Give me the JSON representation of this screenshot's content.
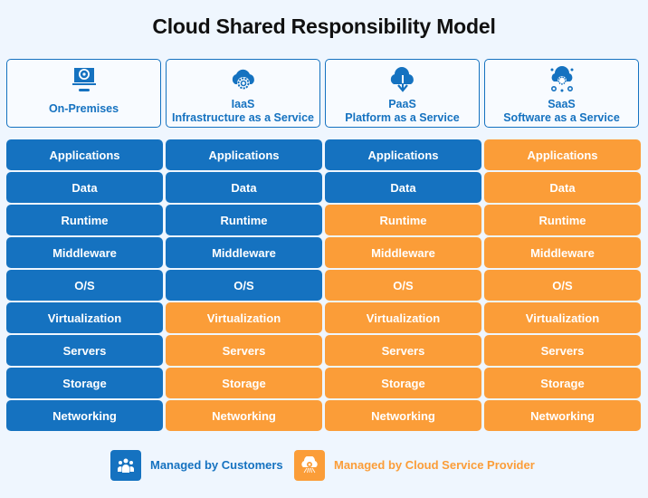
{
  "title": "Cloud Shared Responsibility Model",
  "colors": {
    "customer": "#1572c0",
    "provider": "#fb9d38"
  },
  "columns": [
    {
      "name": "On-Premises",
      "subtitle": "",
      "icon": "monitor-icon"
    },
    {
      "name": "IaaS",
      "subtitle": "Infrastructure as a Service",
      "icon": "cloud-gear-icon"
    },
    {
      "name": "PaaS",
      "subtitle": "Platform as a Service",
      "icon": "cloud-download-icon"
    },
    {
      "name": "SaaS",
      "subtitle": "Software as a Service",
      "icon": "cloud-network-icon"
    }
  ],
  "layers": [
    "Applications",
    "Data",
    "Runtime",
    "Middleware",
    "O/S",
    "Virtualization",
    "Servers",
    "Storage",
    "Networking"
  ],
  "managed_by": {
    "On-Premises": [
      "customer",
      "customer",
      "customer",
      "customer",
      "customer",
      "customer",
      "customer",
      "customer",
      "customer"
    ],
    "IaaS": [
      "customer",
      "customer",
      "customer",
      "customer",
      "customer",
      "provider",
      "provider",
      "provider",
      "provider"
    ],
    "PaaS": [
      "customer",
      "customer",
      "provider",
      "provider",
      "provider",
      "provider",
      "provider",
      "provider",
      "provider"
    ],
    "SaaS": [
      "provider",
      "provider",
      "provider",
      "provider",
      "provider",
      "provider",
      "provider",
      "provider",
      "provider"
    ]
  },
  "legend": {
    "customer": {
      "label": "Managed by Customers",
      "icon": "users-icon"
    },
    "provider": {
      "label": "Managed by Cloud Service Provider",
      "icon": "cloud-service-icon"
    }
  }
}
